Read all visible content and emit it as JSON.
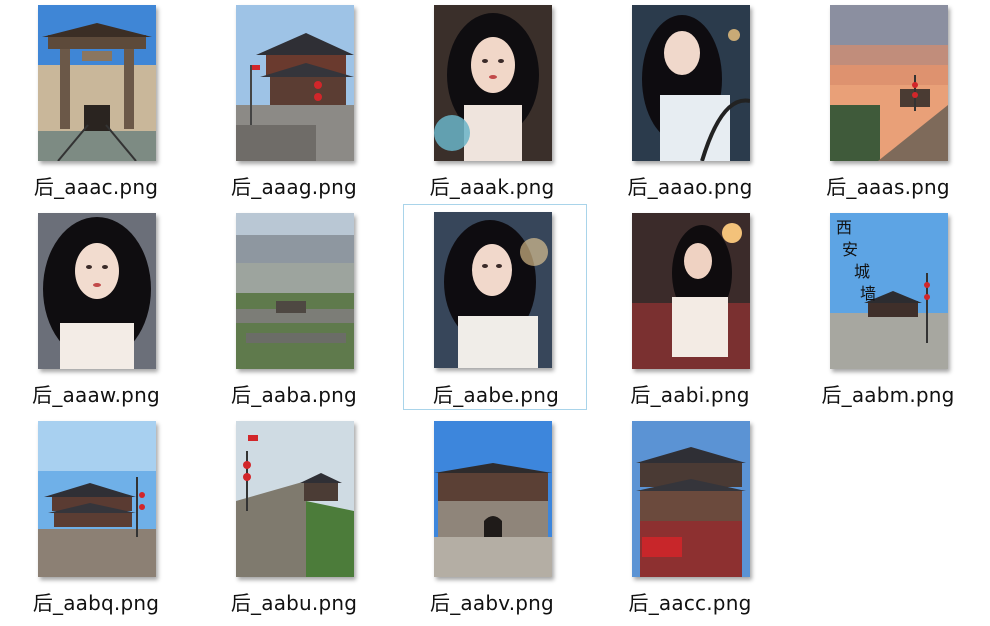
{
  "files": [
    {
      "name": "后_aaac.png",
      "icon": "city-gate-photo"
    },
    {
      "name": "后_aaag.png",
      "icon": "tower-photo"
    },
    {
      "name": "后_aaak.png",
      "icon": "girl-portrait"
    },
    {
      "name": "后_aaao.png",
      "icon": "girl-portrait"
    },
    {
      "name": "后_aaas.png",
      "icon": "sunset-wall-photo"
    },
    {
      "name": "后_aaaw.png",
      "icon": "girl-portrait"
    },
    {
      "name": "后_aaba.png",
      "icon": "city-aerial-photo"
    },
    {
      "name": "后_aabe.png",
      "icon": "girl-portrait"
    },
    {
      "name": "后_aabi.png",
      "icon": "girl-portrait"
    },
    {
      "name": "后_aabm.png",
      "icon": "city-wall-poster"
    },
    {
      "name": "后_aabq.png",
      "icon": "tower-photo"
    },
    {
      "name": "后_aabu.png",
      "icon": "city-wall-photo"
    },
    {
      "name": "后_aabv.png",
      "icon": "city-gate-photo"
    },
    {
      "name": "后_aacc.png",
      "icon": "pavilion-photo"
    }
  ],
  "poster_text": [
    "西",
    "安",
    "城",
    "墙"
  ],
  "selected_index": 7
}
